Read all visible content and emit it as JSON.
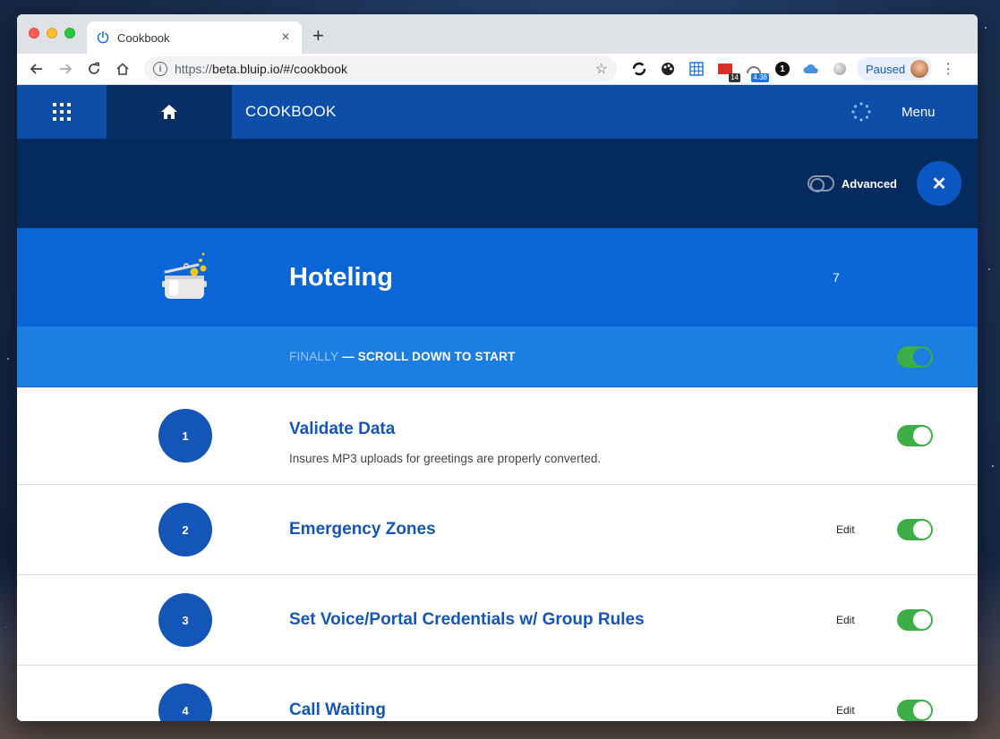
{
  "browser": {
    "tab_title": "Cookbook",
    "tab_close": "×",
    "new_tab": "+",
    "url_scheme": "https://",
    "url_rest": "beta.bluip.io/#/cookbook",
    "ext_badge_mail": "14",
    "ext_badge_speed": "4.38",
    "ext_badge_one": "1",
    "profile_label": "Paused"
  },
  "header": {
    "title": "COOKBOOK",
    "menu_label": "Menu"
  },
  "controls": {
    "advanced_label": "Advanced",
    "close_symbol": "✕"
  },
  "recipe": {
    "title": "Hoteling",
    "count": "7"
  },
  "finally_bar": {
    "prefix": "FINALLY",
    "text": " — SCROLL DOWN TO START",
    "toggle_on": true
  },
  "steps": [
    {
      "number": "1",
      "title": "Validate Data",
      "description": "Insures MP3 uploads for greetings are properly converted.",
      "edit": "",
      "enabled": true
    },
    {
      "number": "2",
      "title": "Emergency Zones",
      "description": "",
      "edit": "Edit",
      "enabled": true
    },
    {
      "number": "3",
      "title": "Set Voice/Portal Credentials w/ Group Rules",
      "description": "",
      "edit": "Edit",
      "enabled": true
    },
    {
      "number": "4",
      "title": "Call Waiting",
      "description": "",
      "edit": "Edit",
      "enabled": true
    }
  ]
}
